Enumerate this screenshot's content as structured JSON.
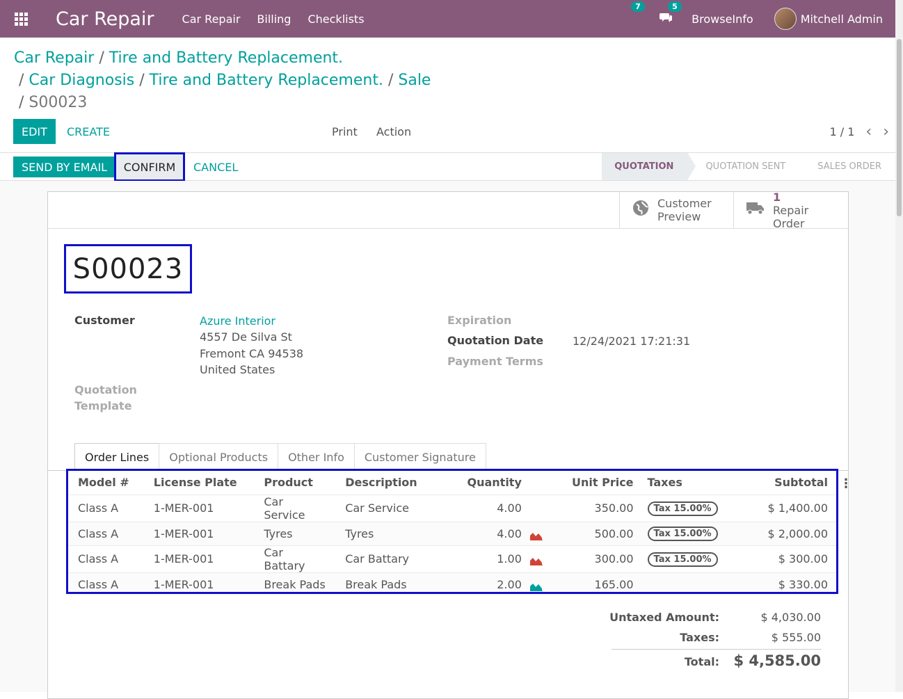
{
  "topbar": {
    "brand": "Car Repair",
    "menu": [
      "Car Repair",
      "Billing",
      "Checklists"
    ],
    "activity_count": "7",
    "message_count": "5",
    "company": "BrowseInfo",
    "user": "Mitchell Admin"
  },
  "breadcrumb": {
    "items": [
      "Car Repair",
      "Tire and Battery Replacement.",
      "Car Diagnosis",
      "Tire and Battery Replacement.",
      "Sale"
    ],
    "current": "S00023"
  },
  "control": {
    "edit": "EDIT",
    "create": "CREATE",
    "print": "Print",
    "action": "Action",
    "pager": "1 / 1"
  },
  "statusbar": {
    "send_email": "SEND BY EMAIL",
    "confirm": "CONFIRM",
    "cancel": "CANCEL",
    "stages": [
      "QUOTATION",
      "QUOTATION SENT",
      "SALES ORDER"
    ]
  },
  "smart_buttons": {
    "preview_line1": "Customer",
    "preview_line2": "Preview",
    "repair_count": "1",
    "repair_label": "Repair Order"
  },
  "record": {
    "name": "S00023",
    "customer_label": "Customer",
    "customer_name": "Azure Interior",
    "address_line1": "4557 De Silva St",
    "address_line2": "Fremont CA 94538",
    "address_line3": "United States",
    "template_label_1": "Quotation",
    "template_label_2": "Template",
    "expiration_label": "Expiration",
    "quotation_date_label": "Quotation Date",
    "quotation_date": "12/24/2021 17:21:31",
    "payment_terms_label": "Payment Terms"
  },
  "tabs": [
    "Order Lines",
    "Optional Products",
    "Other Info",
    "Customer Signature"
  ],
  "order_lines": {
    "columns": [
      "Model #",
      "License Plate",
      "Product",
      "Description",
      "Quantity",
      "Unit Price",
      "Taxes",
      "Subtotal"
    ],
    "rows": [
      {
        "model": "Class A",
        "plate": "1-MER-001",
        "product": "Car Service",
        "description": "Car Service",
        "qty": "4.00",
        "forecast": "",
        "price": "350.00",
        "tax": "Tax 15.00%",
        "subtotal": "$ 1,400.00"
      },
      {
        "model": "Class A",
        "plate": "1-MER-001",
        "product": "Tyres",
        "description": "Tyres",
        "qty": "4.00",
        "forecast": "red",
        "price": "500.00",
        "tax": "Tax 15.00%",
        "subtotal": "$ 2,000.00"
      },
      {
        "model": "Class A",
        "plate": "1-MER-001",
        "product": "Car Battary",
        "description": "Car Battary",
        "qty": "1.00",
        "forecast": "red",
        "price": "300.00",
        "tax": "Tax 15.00%",
        "subtotal": "$ 300.00"
      },
      {
        "model": "Class A",
        "plate": "1-MER-001",
        "product": "Break Pads",
        "description": "Break Pads",
        "qty": "2.00",
        "forecast": "teal",
        "price": "165.00",
        "tax": "",
        "subtotal": "$ 330.00"
      }
    ]
  },
  "totals": {
    "untaxed_label": "Untaxed Amount:",
    "untaxed": "$ 4,030.00",
    "taxes_label": "Taxes:",
    "taxes": "$ 555.00",
    "total_label": "Total:",
    "total": "$ 4,585.00"
  },
  "colors": {
    "brand": "#875a7b",
    "accent": "#00a09d",
    "highlight": "#1010c8"
  }
}
